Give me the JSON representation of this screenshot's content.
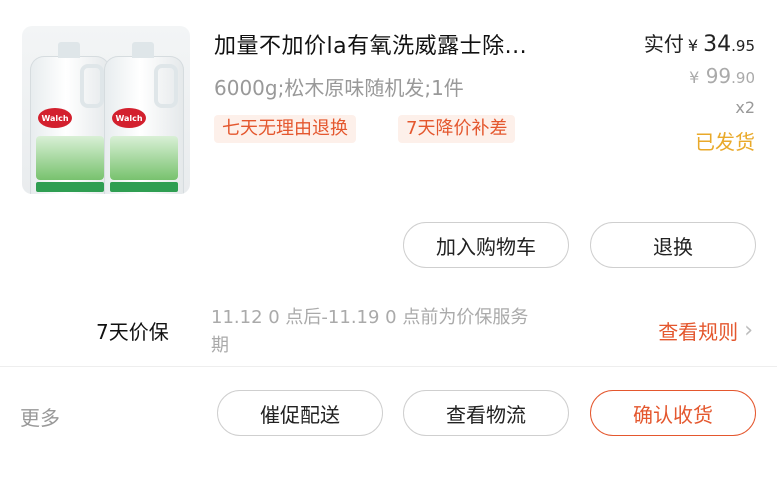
{
  "product": {
    "title": "加量不加价la有氧洗威露士除...",
    "spec": "6000g;松木原味随机发;1件",
    "image_logo": "Walch",
    "tags": [
      "七天无理由退换",
      "7天降价补差"
    ]
  },
  "price": {
    "paid_label": "实付",
    "currency": "¥",
    "paid_int": "34",
    "paid_dec": ".95",
    "original_int": "99",
    "original_dec": ".90",
    "quantity": "x2",
    "status": "已发货"
  },
  "actions_top": {
    "add_to_cart": "加入购物车",
    "return_exchange": "退换"
  },
  "price_guarantee": {
    "label": "7天价保",
    "period": "11.12 0 点后-11.19 0 点前为价保服务期",
    "rules_link": "查看规则"
  },
  "actions_bottom": {
    "more": "更多",
    "urge_delivery": "催促配送",
    "view_logistics": "查看物流",
    "confirm_receipt": "确认收货"
  },
  "colors": {
    "accent": "#e4572e",
    "shipped": "#e9a92a"
  },
  "icons": {
    "rules_arrow": "chevron-right-icon"
  }
}
